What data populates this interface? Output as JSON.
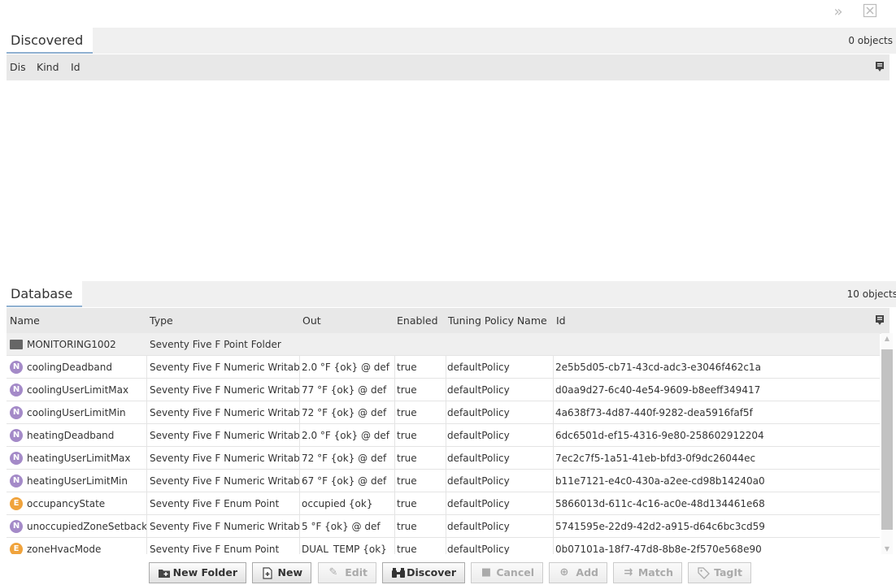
{
  "discovered": {
    "tab_label": "Discovered",
    "count_label": "0 objects",
    "columns": [
      "Dis",
      "Kind",
      "Id"
    ]
  },
  "database": {
    "tab_label": "Database",
    "count_label": "10 objects",
    "columns": [
      "Name",
      "Type",
      "Out",
      "Enabled",
      "Tuning Policy Name",
      "Id"
    ],
    "rows": [
      {
        "icon": "folder",
        "name": "MONITORING1002",
        "type": "Seventy Five F Point Folder",
        "out": "",
        "enabled": "",
        "policy": "",
        "id": ""
      },
      {
        "icon": "N",
        "name": "coolingDeadband",
        "type": "Seventy Five F Numeric Writable",
        "out": "2.0 °F {ok} @ def",
        "enabled": "true",
        "policy": "defaultPolicy",
        "id": "2e5b5d05-cb71-43cd-adc3-e3046f462c1a"
      },
      {
        "icon": "N",
        "name": "coolingUserLimitMax",
        "type": "Seventy Five F Numeric Writable",
        "out": "77 °F {ok} @ def",
        "enabled": "true",
        "policy": "defaultPolicy",
        "id": "d0aa9d27-6c40-4e54-9609-b8eeff349417"
      },
      {
        "icon": "N",
        "name": "coolingUserLimitMin",
        "type": "Seventy Five F Numeric Writable",
        "out": "72 °F {ok} @ def",
        "enabled": "true",
        "policy": "defaultPolicy",
        "id": "4a638f73-4d87-440f-9282-dea5916faf5f"
      },
      {
        "icon": "N",
        "name": "heatingDeadband",
        "type": "Seventy Five F Numeric Writable",
        "out": "2.0 °F {ok} @ def",
        "enabled": "true",
        "policy": "defaultPolicy",
        "id": "6dc6501d-ef15-4316-9e80-258602912204"
      },
      {
        "icon": "N",
        "name": "heatingUserLimitMax",
        "type": "Seventy Five F Numeric Writable",
        "out": "72 °F {ok} @ def",
        "enabled": "true",
        "policy": "defaultPolicy",
        "id": "7ec2c7f5-1a51-41eb-bfd3-0f9dc26044ec"
      },
      {
        "icon": "N",
        "name": "heatingUserLimitMin",
        "type": "Seventy Five F Numeric Writable",
        "out": "67 °F {ok} @ def",
        "enabled": "true",
        "policy": "defaultPolicy",
        "id": "b11e7121-e4c0-430a-a2ee-cd98b14240a0"
      },
      {
        "icon": "E",
        "name": "occupancyState",
        "type": "Seventy Five F Enum Point",
        "out": "occupied {ok}",
        "enabled": "true",
        "policy": "defaultPolicy",
        "id": "5866013d-611c-4c16-ac0e-48d134461e68"
      },
      {
        "icon": "N",
        "name": "unoccupiedZoneSetback",
        "type": "Seventy Five F Numeric Writable",
        "out": "5 °F {ok} @ def",
        "enabled": "true",
        "policy": "defaultPolicy",
        "id": "5741595e-22d9-42d2-a915-d64c6bc3cd59"
      },
      {
        "icon": "E",
        "name": "zoneHvacMode",
        "type": "Seventy Five F Enum Point",
        "out": "DUAL_TEMP {ok}",
        "enabled": "true",
        "policy": "defaultPolicy",
        "id": "0b07101a-18f7-47d8-8b8e-2f570e568e90"
      }
    ]
  },
  "buttons": [
    {
      "label": "New Folder",
      "icon": "new-folder-icon",
      "enabled": true
    },
    {
      "label": "New",
      "icon": "new-document-icon",
      "enabled": true
    },
    {
      "label": "Edit",
      "icon": "pencil-icon",
      "enabled": false
    },
    {
      "label": "Discover",
      "icon": "binoculars-icon",
      "enabled": true
    },
    {
      "label": "Cancel",
      "icon": "stop-icon",
      "enabled": false
    },
    {
      "label": "Add",
      "icon": "add-icon",
      "enabled": false
    },
    {
      "label": "Match",
      "icon": "match-arrow-icon",
      "enabled": false
    },
    {
      "label": "TagIt",
      "icon": "tag-icon",
      "enabled": false
    }
  ]
}
